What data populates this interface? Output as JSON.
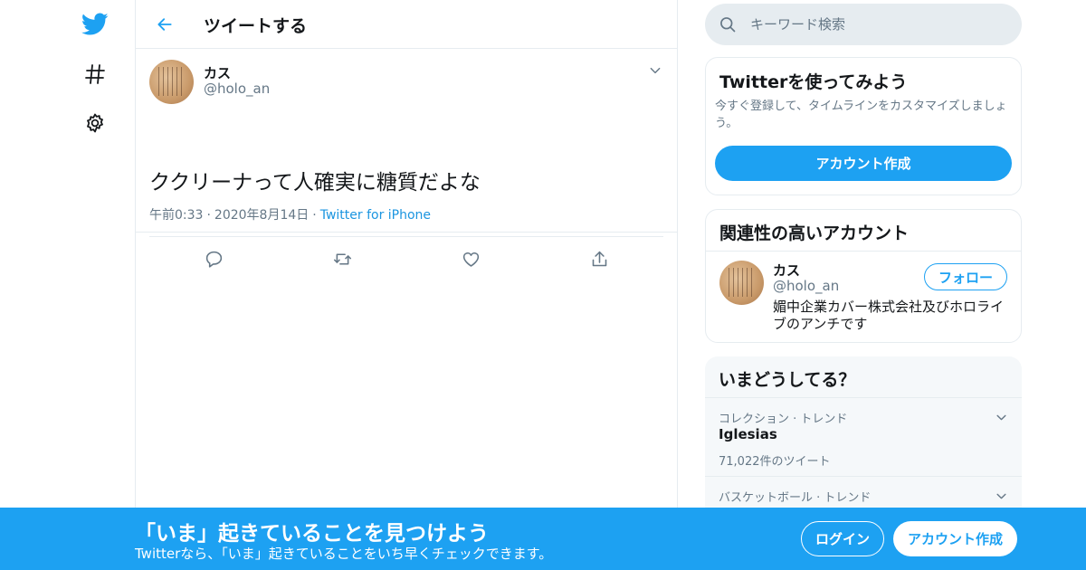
{
  "colors": {
    "accent": "#1da1f2",
    "muted": "#657786",
    "border": "#e6ecf0"
  },
  "nav": {
    "icons": [
      "twitter-logo-icon",
      "hashtag-icon",
      "gear-icon"
    ]
  },
  "header": {
    "back_icon": "arrow-left-icon",
    "title": "ツイートする"
  },
  "tweet": {
    "name": "カス",
    "handle": "@holo_an",
    "text": "ククリーナって人確実に糖質だよな",
    "time": "午前0:33",
    "date": "2020年8月14日",
    "source": "Twitter for iPhone",
    "actions": [
      "reply-icon",
      "retweet-icon",
      "like-icon",
      "share-icon"
    ]
  },
  "search": {
    "placeholder": "キーワード検索"
  },
  "signup": {
    "title": "Twitterを使ってみよう",
    "description": "今すぐ登録して、タイムラインをカスタマイズしましょう。",
    "button": "アカウント作成"
  },
  "related": {
    "title": "関連性の高いアカウント",
    "name": "カス",
    "handle": "@holo_an",
    "follow": "フォロー",
    "bio": "媚中企業カバー株式会社及びホロライブのアンチです"
  },
  "trends": {
    "title": "いまどうしてる？",
    "items": [
      {
        "category": "コレクション · トレンド",
        "name": "Iglesias",
        "count": "71,022件のツイート"
      },
      {
        "category": "バスケットボール · トレンド",
        "name": "",
        "count": ""
      }
    ]
  },
  "banner": {
    "title": "「いま」起きていることを見つけよう",
    "subtitle": "Twitterなら、「いま」起きていることをいち早くチェックできます。",
    "login": "ログイン",
    "create": "アカウント作成"
  }
}
